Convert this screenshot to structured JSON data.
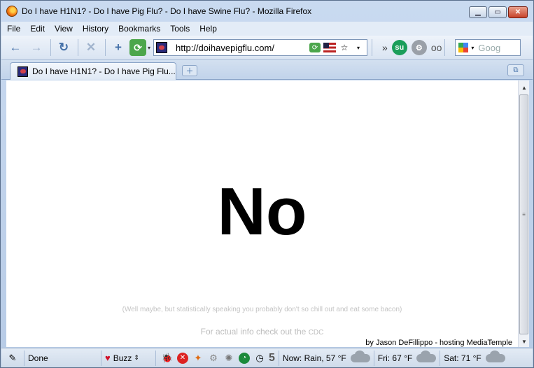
{
  "window": {
    "title": "Do I have H1N1? - Do I have Pig Flu? - Do I have Swine Flu? - Mozilla Firefox"
  },
  "menu": [
    "File",
    "Edit",
    "View",
    "History",
    "Bookmarks",
    "Tools",
    "Help"
  ],
  "navbar": {
    "url": "http://doihavepigflu.com/",
    "search_placeholder": "Goog"
  },
  "tabs": [
    {
      "label": "Do I have H1N1? - Do I have Pig Flu..."
    }
  ],
  "page": {
    "answer": "No",
    "note": "(Well maybe, but statistically speaking you probably don't so chill out and eat some bacon)",
    "info_prefix": "For actual info check out the",
    "info_link": "CDC",
    "credit": "by Jason DeFillippo - hosting MediaTemple"
  },
  "status": {
    "text": "Done",
    "buzz": "Buzz",
    "counter": "5",
    "weather": [
      "Now: Rain, 57 °F",
      "Fri: 67 °F",
      "Sat: 71 °F"
    ]
  },
  "colors": {
    "chrome": "#c9daf0",
    "answer": "#000000",
    "faint_text": "#c4c4c4"
  }
}
